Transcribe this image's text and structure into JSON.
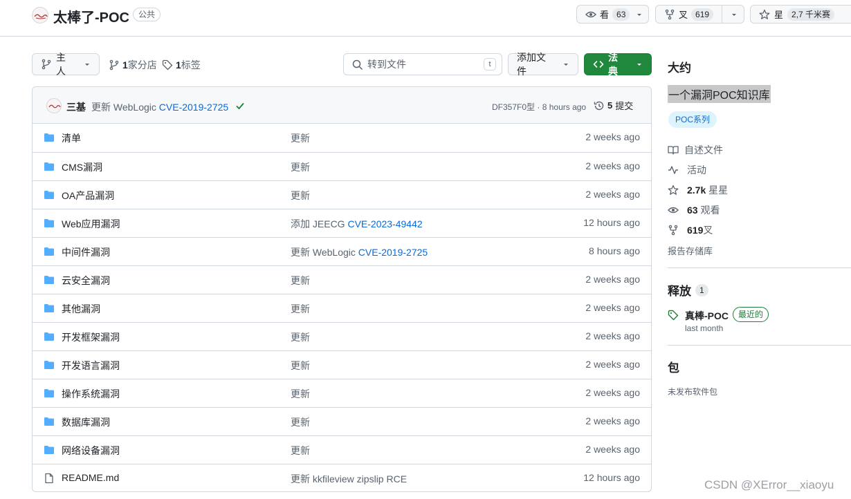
{
  "header": {
    "repo_name": "太棒了-POC",
    "visibility": "公共",
    "watch": {
      "label": "看",
      "count": "63"
    },
    "fork": {
      "label": "叉",
      "count": "619"
    },
    "star": {
      "label": "星",
      "count": "2,7 千米赛"
    }
  },
  "toolbar": {
    "branch": "主人",
    "branches_count": "1",
    "branches_label": "家分店",
    "tags_count": "1",
    "tags_label": "标签",
    "search_placeholder": "转到文件",
    "search_key": "t",
    "add_file": "添加文件",
    "code": "法典"
  },
  "commit": {
    "author": "三基",
    "message": "更新 WebLogic ",
    "message_link": "CVE-2019-2725",
    "hash": "DF357F0型",
    "separator": "·",
    "time": "8 hours ago",
    "commits_count": "5",
    "commits_label": "提交"
  },
  "files": [
    {
      "type": "folder",
      "name": "清单",
      "msg": "更新",
      "link": "",
      "date": "2 weeks ago"
    },
    {
      "type": "folder",
      "name": "CMS漏洞",
      "msg": "更新",
      "link": "",
      "date": "2 weeks ago"
    },
    {
      "type": "folder",
      "name": "OA产品漏洞",
      "msg": "更新",
      "link": "",
      "date": "2 weeks ago"
    },
    {
      "type": "folder",
      "name": "Web应用漏洞",
      "msg": "添加 JEECG ",
      "link": "CVE-2023-49442",
      "date": "12 hours ago"
    },
    {
      "type": "folder",
      "name": "中间件漏洞",
      "msg": "更新 WebLogic ",
      "link": "CVE-2019-2725",
      "date": "8 hours ago"
    },
    {
      "type": "folder",
      "name": "云安全漏洞",
      "msg": "更新",
      "link": "",
      "date": "2 weeks ago"
    },
    {
      "type": "folder",
      "name": "其他漏洞",
      "msg": "更新",
      "link": "",
      "date": "2 weeks ago"
    },
    {
      "type": "folder",
      "name": "开发框架漏洞",
      "msg": "更新",
      "link": "",
      "date": "2 weeks ago"
    },
    {
      "type": "folder",
      "name": "开发语言漏洞",
      "msg": "更新",
      "link": "",
      "date": "2 weeks ago"
    },
    {
      "type": "folder",
      "name": "操作系统漏洞",
      "msg": "更新",
      "link": "",
      "date": "2 weeks ago"
    },
    {
      "type": "folder",
      "name": "数据库漏洞",
      "msg": "更新",
      "link": "",
      "date": "2 weeks ago"
    },
    {
      "type": "folder",
      "name": "网络设备漏洞",
      "msg": "更新",
      "link": "",
      "date": "2 weeks ago"
    },
    {
      "type": "file",
      "name": "README.md",
      "msg": "更新 kkfileview zipslip RCE",
      "link": "",
      "date": "12 hours ago"
    }
  ],
  "sidebar": {
    "about_title": "大约",
    "description": "一个漏洞POC知识库",
    "topic": "POC系列",
    "readme": "自述文件",
    "activity": "活动",
    "stars_count": "2.7k",
    "stars_label": " 星星",
    "watch_count": "63",
    "watch_label": " 观看",
    "fork_count": "619",
    "fork_label": "叉",
    "report": "报告存储库",
    "releases_title": "释放",
    "releases_count": "1",
    "release_name": "真棒-POC",
    "release_badge": "最近的",
    "release_time": "last month",
    "packages_title": "包",
    "packages_empty": "未发布软件包"
  },
  "watermark": "CSDN @XError__xiaoyu",
  "colors": {
    "accent": "#0969da",
    "success": "#1f883d",
    "border": "#d0d7de",
    "folder": "#54aeff",
    "muted": "#59636e"
  }
}
